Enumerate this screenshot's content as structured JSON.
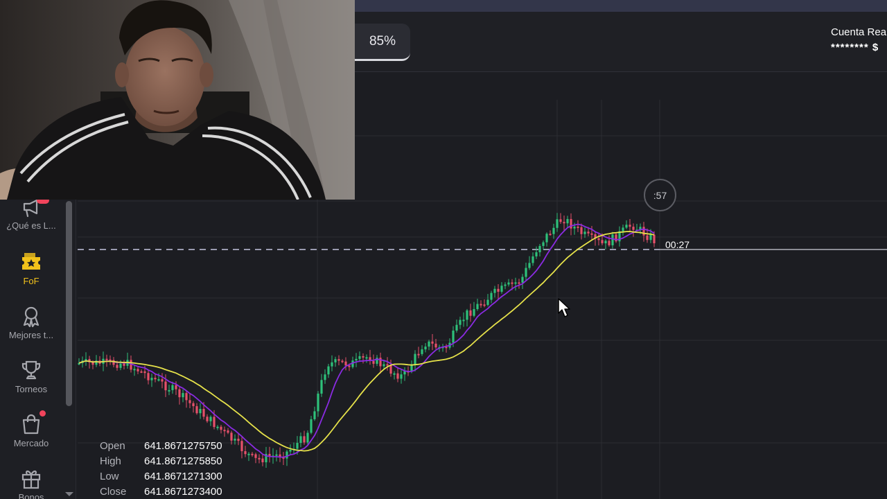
{
  "header": {
    "payout": "85%",
    "account_title": "Cuenta Rea",
    "account_balance": "******** $"
  },
  "sidebar": {
    "items": [
      {
        "label": "¿Qué es L...",
        "icon": "megaphone-icon",
        "active": false,
        "badge": true
      },
      {
        "label": "FoF",
        "icon": "ticket-star-icon",
        "active": true,
        "badge": false
      },
      {
        "label": "Mejores t...",
        "icon": "ribbon-award-icon",
        "active": false,
        "badge": false
      },
      {
        "label": "Torneos",
        "icon": "trophy-icon",
        "active": false,
        "badge": false
      },
      {
        "label": "Mercado",
        "icon": "shopping-bag-icon",
        "active": false,
        "badge": true
      },
      {
        "label": "Bonos",
        "icon": "gift-icon",
        "active": false,
        "badge": false
      }
    ]
  },
  "chart": {
    "timer": ":57",
    "countdown": "00:27",
    "colors": {
      "up": "#2ec07a",
      "down": "#e5506a",
      "ma_fast": "#8a2be2",
      "ma_slow": "#e6e24a",
      "grid": "#2c2d33",
      "price_line": "#9a9bb0"
    }
  },
  "ohlc": {
    "open_label": "Open",
    "open_value": "641.8671275750",
    "high_label": "High",
    "high_value": "641.8671275850",
    "low_label": "Low",
    "low_value": "641.8671271300",
    "close_label": "Close",
    "close_value": "641.8671273400"
  }
}
